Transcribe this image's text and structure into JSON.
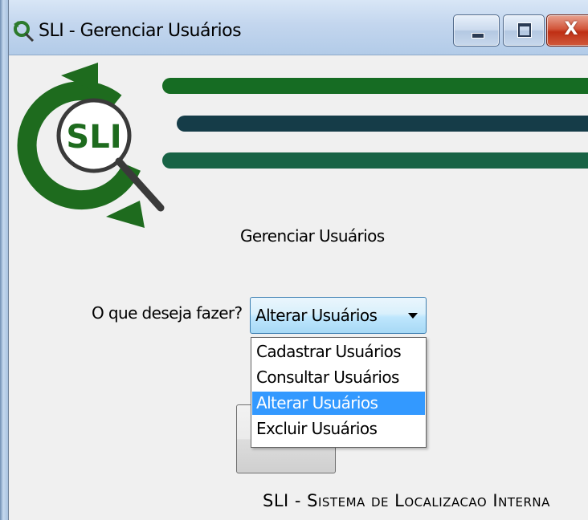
{
  "window": {
    "title": "SLI - Gerenciar Usuários",
    "controls": {
      "minimize": "minimize",
      "maximize": "maximize",
      "close": "X"
    }
  },
  "logo": {
    "text": "SLI"
  },
  "main": {
    "heading": "Gerenciar Usuários",
    "prompt_label": "O que deseja fazer?",
    "action_select": {
      "value": "Alterar Usuários",
      "options": [
        "Cadastrar Usuários",
        "Consultar Usuários",
        "Alterar Usuários",
        "Excluir Usuários"
      ],
      "selected_index": 2
    }
  },
  "footer": {
    "text": "SLI - Sistema de Localizacao Interna"
  },
  "colors": {
    "logo_green": "#1e6b1e",
    "bar_green": "#166c23",
    "bar_dark": "#153c48",
    "bar_teal": "#186345",
    "selection_blue": "#3399ff",
    "combo_border": "#3c7fb1"
  },
  "icons": [
    "app-icon",
    "minimize-icon",
    "maximize-icon",
    "close-icon",
    "dropdown-arrow-icon",
    "magnifier-icon"
  ]
}
